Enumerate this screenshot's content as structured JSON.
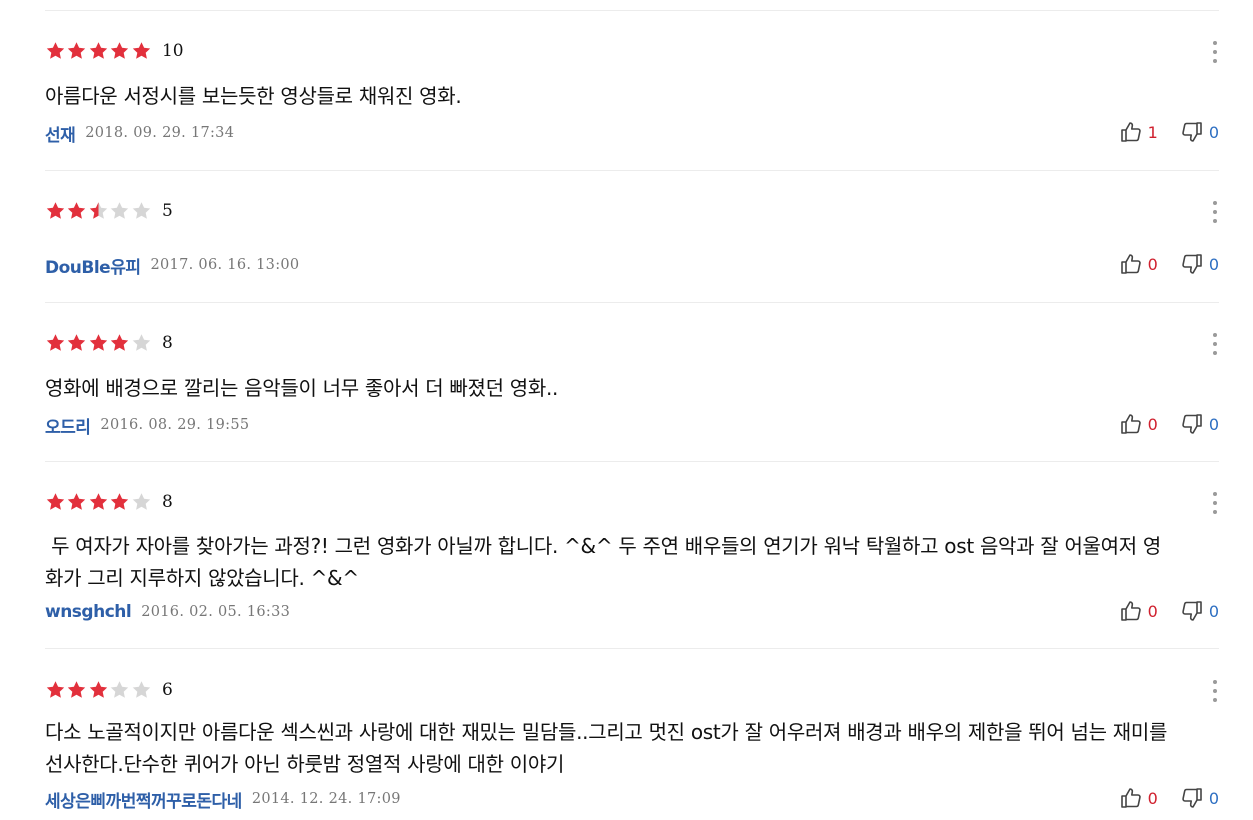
{
  "colors": {
    "star_on": "#e2303c",
    "star_off": "#d6d6d6",
    "author": "#2e5fa8",
    "like": "#d0202e",
    "dislike": "#2e6fc2"
  },
  "icons": {
    "star": "star-icon",
    "more": "more-vertical-icon",
    "like": "thumbs-up-icon",
    "dislike": "thumbs-down-icon"
  },
  "reviews": [
    {
      "rating": 10,
      "score": "10",
      "text": "아름다운 서정시를 보는듯한 영상들로 채워진 영화.",
      "author": "선재",
      "date": "2018. 09. 29. 17:34",
      "likes": "1",
      "dislikes": "0"
    },
    {
      "rating": 5,
      "score": "5",
      "text": "",
      "author": "DouBle유피",
      "date": "2017. 06. 16. 13:00",
      "likes": "0",
      "dislikes": "0"
    },
    {
      "rating": 8,
      "score": "8",
      "text": "영화에 배경으로 깔리는 음악들이 너무 좋아서 더 빠졌던 영화..",
      "author": "오드리",
      "date": "2016. 08. 29. 19:55",
      "likes": "0",
      "dislikes": "0"
    },
    {
      "rating": 8,
      "score": "8",
      "text": " 두 여자가 자아를 찾아가는 과정?! 그런 영화가 아닐까 합니다. ^&^ 두 주연 배우들의 연기가 워낙 탁월하고 ost 음악과 잘 어울여저 영화가 그리 지루하지 않았습니다. ^&^",
      "author": "wnsghchl",
      "date": "2016. 02. 05. 16:33",
      "likes": "0",
      "dislikes": "0"
    },
    {
      "rating": 6,
      "score": "6",
      "text": "다소 노골적이지만 아름다운 섹스씬과 사랑에 대한 재밌는 밀담들..그리고 멋진 ost가 잘 어우러져 배경과 배우의 제한을 뛰어 넘는 재미를 선사한다.단수한 퀴어가 아닌 하룻밤 정열적 사랑에 대한 이야기",
      "author": "세상은삐까번쩍꺼꾸로돈다네",
      "date": "2014. 12. 24. 17:09",
      "likes": "0",
      "dislikes": "0"
    }
  ]
}
